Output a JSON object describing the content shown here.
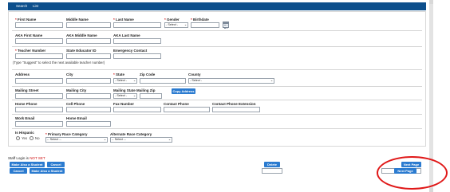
{
  "tabs": [
    "Search",
    "List"
  ],
  "form": {
    "row1": {
      "first_name": "First Name",
      "middle_name": "Middle Name",
      "last_name": "Last Name",
      "gender": "Gender",
      "gender_value": "- Select -",
      "birthdate": "Birthdate"
    },
    "row2": {
      "aka_first": "AKA First Name",
      "aka_middle": "AKA Middle Name",
      "aka_last": "AKA Last Name"
    },
    "row3": {
      "teacher_number": "Teacher Number",
      "state_educator_id": "State Educator ID",
      "emergency_contact": "Emergency Contact"
    },
    "hint": "(Type \"Suggest\" to select the next available teacher number)",
    "address": {
      "address": "Address",
      "city": "City",
      "state": "State",
      "state_value": "- Select -",
      "zip": "Zip Code",
      "county": "County",
      "county_value": "- Select -"
    },
    "mailing": {
      "street": "Mailing Street",
      "city": "Mailing City",
      "state_zip": "Mailing State Mailing Zip",
      "state_value": "- Select -",
      "copy_button": "Copy Address"
    },
    "phones": {
      "home": "Home Phone",
      "cell": "Cell Phone",
      "fax": "Fax Number",
      "contact": "Contact Phone",
      "contact_ext": "Contact Phone Extension"
    },
    "emails": {
      "work": "Work Email",
      "home": "Home Email"
    },
    "demographics": {
      "hispanic": "Is Hispanic",
      "yes": "Yes",
      "no": "No",
      "primary_race": "Primary Race Category",
      "primary_value": "-- Select --",
      "alternate_race": "Alternate Race Category",
      "alternate_value": "-- Select --"
    }
  },
  "footer": {
    "login_label": "Staff Login is ",
    "login_status": "NOT SET",
    "make_also_student": "Make Also a Student",
    "cancel": "Cancel",
    "delete": "Delete",
    "next_page": "Next Page"
  },
  "colors": {
    "header": "#0d4f8c",
    "button": "#2b7bd0",
    "required": "#d01010",
    "annotation_circle": "#e01818"
  }
}
